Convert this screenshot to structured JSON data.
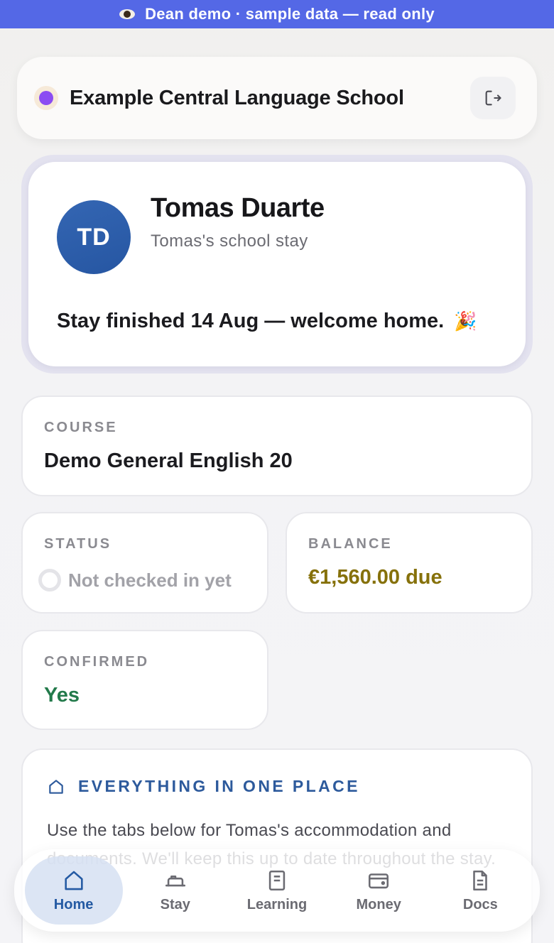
{
  "banner": {
    "text": "Dean demo · sample data — read only",
    "icon": "eye-icon"
  },
  "header": {
    "school_name": "Example Central Language School",
    "logout_icon": "logout-icon"
  },
  "profile": {
    "initials": "TD",
    "name": "Tomas Duarte",
    "subtitle": "Tomas's school stay",
    "message": "Stay finished 14 Aug — welcome home.",
    "message_emoji": "🎉"
  },
  "course": {
    "label": "COURSE",
    "value": "Demo General English 20"
  },
  "status": {
    "label": "STATUS",
    "value": "Not checked in yet"
  },
  "balance": {
    "label": "BALANCE",
    "value": "€1,560.00 due"
  },
  "confirmed": {
    "label": "CONFIRMED",
    "value": "Yes"
  },
  "info": {
    "title": "EVERYTHING IN ONE PLACE",
    "body": "Use the tabs below for Tomas's accommodation and documents. We'll keep this up to date throughout the stay."
  },
  "nav": [
    {
      "label": "Home",
      "icon": "home-icon",
      "active": true
    },
    {
      "label": "Stay",
      "icon": "bed-icon",
      "active": false
    },
    {
      "label": "Learning",
      "icon": "notebook-icon",
      "active": false
    },
    {
      "label": "Money",
      "icon": "wallet-icon",
      "active": false
    },
    {
      "label": "Docs",
      "icon": "document-icon",
      "active": false
    }
  ],
  "colors": {
    "banner": "#5468e6",
    "accent": "#2d5a9c",
    "balance": "#86710b",
    "confirmed": "#237a4b",
    "school_dot": "#8b4cf2"
  }
}
